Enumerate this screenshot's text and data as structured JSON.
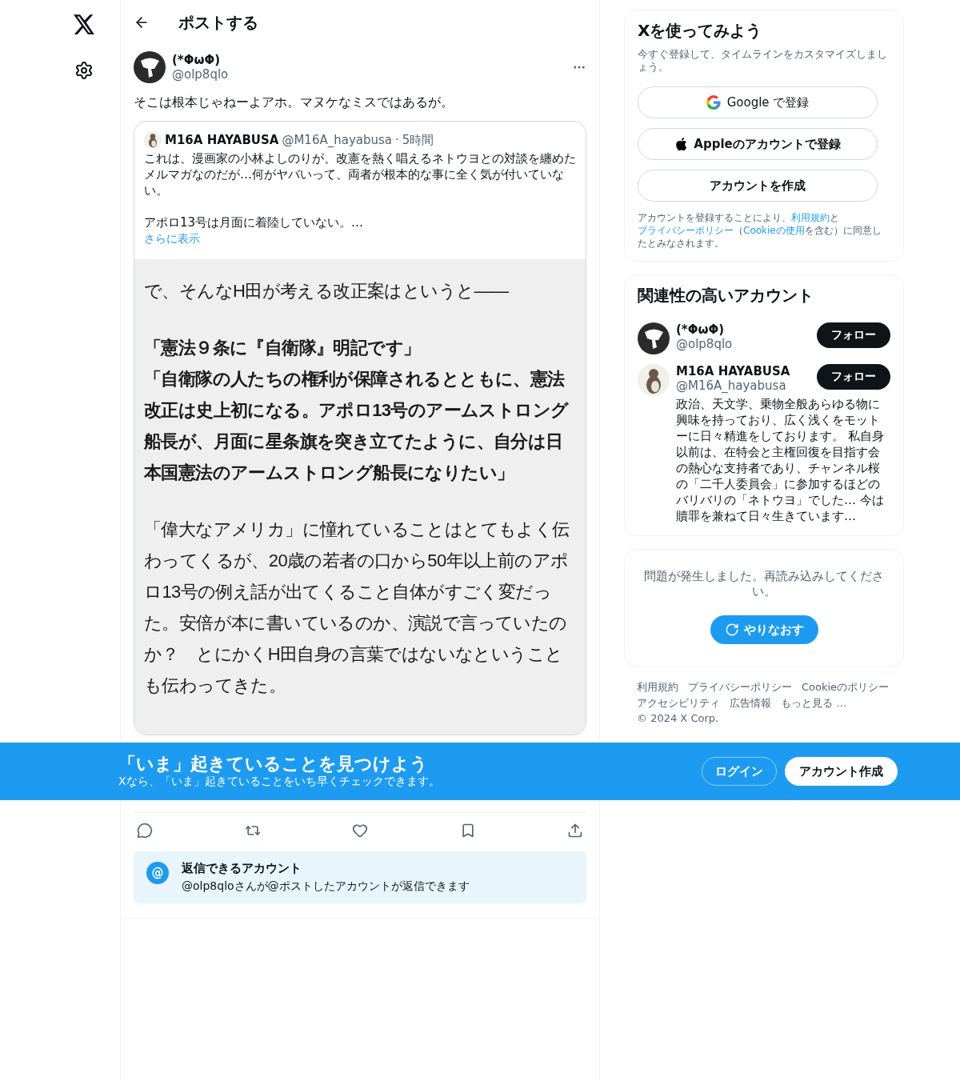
{
  "header": {
    "title": "ポストする"
  },
  "post": {
    "name": "(*ΦωΦ)",
    "handle": "@olp8qlo",
    "text": "そこは根本じゃねーよアホ。マヌケなミスではあるが。",
    "quote": {
      "name": "M16A HAYABUSA",
      "handle": "@M16A_hayabusa",
      "separator": "·",
      "time": "5時間",
      "paragraphs": [
        "これは、漫画家の小林よしのりが、改憲を熱く唱えるネトウヨとの対談を纏めたメルマガなのだが…何がヤバいって、両者が根本的な事に全く気が付いていない。",
        "アポロ13号は月面に着陸していない。…"
      ],
      "more": "さらに表示",
      "document": [
        {
          "kind": "plain",
          "lines": [
            "で、そんなH田が考える改正案はというと――"
          ]
        },
        {
          "kind": "bold",
          "lines": [
            "「憲法９条に『自衛隊』明記です」",
            "「自衛隊の人たちの権利が保障されるとともに、憲法改正は史上初になる。アポロ13号のアームストロング船長が、月面に星条旗を突き立てたように、自分は日本国憲法のアームストロング船長になりたい」"
          ]
        },
        {
          "kind": "plain",
          "lines": [
            "「偉大なアメリカ」に憧れていることはとてもよく伝わってくるが、20歳の若者の口から50年以上前のアポロ13号の例え話が出てくること自体がすごく変だった。安倍が本に書いているのか、演説で言っていたのか？　とにかくH田自身の言葉ではないなということも伝わってきた。"
          ]
        }
      ]
    }
  },
  "reply_notice": {
    "icon": "@",
    "title": "返信できるアカウント",
    "text": "@olp8qloさんが@ポストしたアカウントが返信できます"
  },
  "signup": {
    "title": "Xを使ってみよう",
    "subtitle": "今すぐ登録して、タイムラインをカスタマイズしましょう。",
    "buttons": [
      {
        "kind": "google",
        "label": "Google で登録"
      },
      {
        "kind": "apple",
        "label": "Appleのアカウントで登録"
      },
      {
        "kind": "create",
        "label": "アカウントを作成"
      }
    ],
    "legal": [
      {
        "text": "アカウントを登録することにより、",
        "link": false
      },
      {
        "text": "利用規約",
        "link": true
      },
      {
        "text": "と",
        "link": false
      },
      {
        "text": "プライバシーポリシー",
        "link": true
      },
      {
        "text": "（",
        "link": false
      },
      {
        "text": "Cookieの使用",
        "link": true
      },
      {
        "text": "を含む）に同意したとみなされます。",
        "link": false
      }
    ]
  },
  "related": {
    "title": "関連性の高いアカウント",
    "accounts": [
      {
        "kind": "question",
        "name": "(*ΦωΦ)",
        "handle": "@olp8qlo",
        "follow": "フォロー"
      },
      {
        "kind": "bird",
        "name": "M16A HAYABUSA",
        "handle": "@M16A_hayabusa",
        "follow": "フォロー",
        "bio": "政治、天文学、乗物全般あらゆる物に興味を持っており、広く浅くをモットーに日々精進をしております。 私自身以前は、在特会と主権回復を目指す会の熱心な支持者であり、チャンネル桜の「二千人委員会」に参加するほどのバリバリの「ネトウヨ」でした… 今は贖罪を兼ねて日々生きています…"
      }
    ]
  },
  "error": {
    "message": "問題が発生しました。再読み込みしてください。",
    "retry": "やりなおす"
  },
  "footer": {
    "links": [
      "利用規約",
      "プライバシーポリシー",
      "Cookieのポリシー",
      "アクセシビリティ",
      "広告情報",
      "もっと見る …"
    ],
    "copyright": "© 2024 X Corp."
  },
  "banner": {
    "title": "「いま」起きていることを見つけよう",
    "subtitle": "Xなら、「いま」起きていることをいち早くチェックできます。",
    "login": "ログイン",
    "signup": "アカウント作成"
  }
}
